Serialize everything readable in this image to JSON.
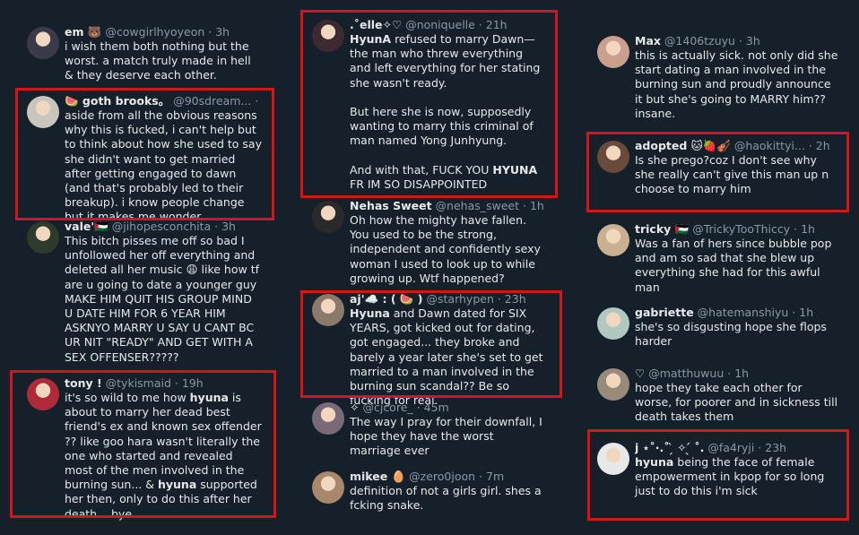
{
  "colors": {
    "background": "#15202b",
    "text": "#e7e9ea",
    "muted": "#8b98a5",
    "highlight_frame": "#d4161b"
  },
  "tweets": [
    {
      "id": "t1",
      "name": "em 🐻",
      "handle": "@cowgirlhyoyeon",
      "time": "3h",
      "text": "i wish them both nothing but the worst. a match truly made in hell & they deserve each other.",
      "avatar": "#3a3a4a"
    },
    {
      "id": "t2",
      "name": "🍉 goth brooks。",
      "handle": "@90sdream...",
      "time": "3h",
      "text": "aside from all the obvious reasons why this is fucked, i can't help but to think about how she used to say she didn't want to get married after getting engaged to dawn (and that's probably led to their breakup). i know people change but it makes me wonder...",
      "avatar": "#c9c4bc"
    },
    {
      "id": "t3",
      "name": "vale'🇵🇸",
      "handle": "@jihopesconchita",
      "time": "3h",
      "text": "This bitch pisses me off so bad I unfollowed her off everything and deleted all her music 😩 like how tf are u going to date a younger guy MAKE HIM QUIT HIS GROUP MIND U DATE HIM FOR 6 YEAR HIM ASKNYO MARRY U SAY U CANT BC UR NIT \"READY\" AND GET WITH A SEX OFFENSER?????",
      "avatar": "#2c3b2c"
    },
    {
      "id": "t4",
      "name": "tony !",
      "handle": "@tykismaid",
      "time": "19h",
      "text_parts": [
        {
          "t": "it's so wild to me how "
        },
        {
          "b": "hyuna"
        },
        {
          "t": " is about to marry her dead best friend's ex and known sex offender ?? like goo hara wasn't literally the one who started and revealed most of the men involved in the burning sun... & "
        },
        {
          "b": "hyuna"
        },
        {
          "t": " supported her then, only to do this after her death... bye."
        }
      ],
      "avatar": "#b02a3a"
    },
    {
      "id": "t5",
      "name": ".˚elle✧♡",
      "handle": "@noniquelle",
      "time": "21h",
      "text_parts": [
        {
          "b": "HyunA"
        },
        {
          "t": " refused to marry Dawn— the man who threw everything and left everything for her stating she wasn't ready.\n\nBut here she is now, supposedly wanting to marry this criminal of man named Yong Junhyung.\n\nAnd with that, FUCK YOU "
        },
        {
          "b": "HYUNA"
        },
        {
          "t": " FR IM SO DISAPPOINTED"
        }
      ],
      "avatar": "#3d2a30"
    },
    {
      "id": "t6",
      "name": "Nehas Sweet",
      "handle": "@nehas_sweet",
      "time": "1h",
      "text": "Oh how the mighty have fallen. You used to be the strong, independent and confidently sexy woman I used to look up to while growing up. Wtf happened?",
      "avatar": "#2a2a2a"
    },
    {
      "id": "t7",
      "name": "aj'☁️ : ( 🍉 )",
      "handle": "@starhypen",
      "time": "23h",
      "text_parts": [
        {
          "b": "Hyuna"
        },
        {
          "t": " and Dawn dated for SIX YEARS, got kicked out for dating, got engaged... they broke and barely a year later she's set to get married to a man involved in the burning sun scandal?? Be so fucking for real."
        }
      ],
      "avatar": "#8a7a6a"
    },
    {
      "id": "t8",
      "name": "✧",
      "handle": "@cjcore_",
      "time": "45m",
      "text": "The way I pray for their downfall, I hope they have the worst marriage ever",
      "avatar": "#7a6a78"
    },
    {
      "id": "t9",
      "name": "mikee 🥚",
      "handle": "@zero0joon",
      "time": "7m",
      "text": "definition of not a girls girl. shes a fcking snake.",
      "avatar": "#a8876a"
    },
    {
      "id": "t10",
      "name": "Max",
      "handle": "@1406tzuyu",
      "time": "3h",
      "text": "this is actually sick. not only did she start dating a man involved in the burning sun and proudly announce it but she's going to MARRY him?? insane.",
      "avatar": "#c9a08e"
    },
    {
      "id": "t11",
      "name": "adopted 🐱🍓🎻",
      "handle": "@haokittyi...",
      "time": "2h",
      "text": "Is she prego?coz I don't see why she really can't give this man up n choose to marry him",
      "avatar": "#6a4a3a"
    },
    {
      "id": "t12",
      "name": "tricky 🇵🇸",
      "handle": "@TrickyTooThiccy",
      "time": "1h",
      "text": "Was a fan of hers since bubble pop and am so sad that she blew up everything she had for this awful man",
      "avatar": "#c8b090"
    },
    {
      "id": "t13",
      "name": "gabriette",
      "handle": "@hatemanshiyu",
      "time": "1h",
      "text": "she's so disgusting hope she flops harder",
      "avatar": "#b0c8c0"
    },
    {
      "id": "t14",
      "name": "♡",
      "handle": "@matthuwuu",
      "time": "1h",
      "text": "hope they take each other for worse, for poorer and in sickness till death takes them",
      "avatar": "#9a8a7a"
    },
    {
      "id": "t15",
      "name": "j ⋆˚·.˚ ̗̀ ✧ ̖́ ˚.",
      "handle": "@fa4ryji",
      "time": "23h",
      "text_parts": [
        {
          "b": "hyuna"
        },
        {
          "t": " being the face of female empowerment in kpop for so long just to do this i'm sick"
        }
      ],
      "avatar": "#e8e8e8"
    }
  ]
}
